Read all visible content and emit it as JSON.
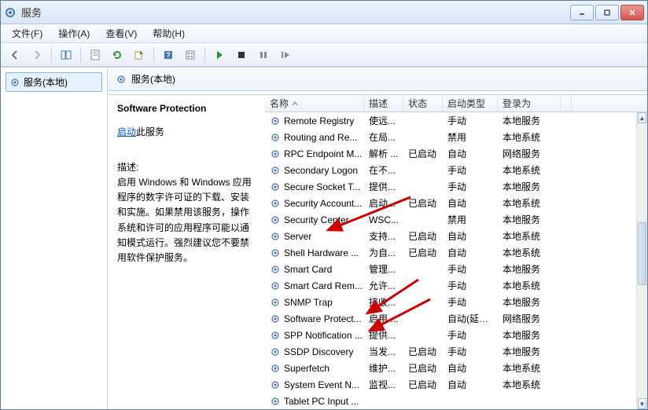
{
  "window": {
    "title": "服务"
  },
  "menu": {
    "file": "文件(F)",
    "action": "操作(A)",
    "view": "查看(V)",
    "help": "帮助(H)"
  },
  "tree": {
    "root": "服务(本地)"
  },
  "panel": {
    "heading": "服务(本地)"
  },
  "details": {
    "title": "Software Protection",
    "start_label": "启动",
    "start_suffix": "此服务",
    "desc_label": "描述:",
    "desc_text": "启用 Windows 和 Windows 应用程序的数字许可证的下载、安装和实施。如果禁用该服务，操作系统和许可的应用程序可能以通知模式运行。强烈建议您不要禁用软件保护服务。"
  },
  "columns": {
    "name": "名称",
    "desc": "描述",
    "status": "状态",
    "startup": "启动类型",
    "logon": "登录为"
  },
  "rows": [
    {
      "name": "Remote Registry",
      "desc": "使远...",
      "status": "",
      "startup": "手动",
      "logon": "本地服务"
    },
    {
      "name": "Routing and Re...",
      "desc": "在局...",
      "status": "",
      "startup": "禁用",
      "logon": "本地系统"
    },
    {
      "name": "RPC Endpoint M...",
      "desc": "解析 ...",
      "status": "已启动",
      "startup": "自动",
      "logon": "网络服务"
    },
    {
      "name": "Secondary Logon",
      "desc": "在不...",
      "status": "",
      "startup": "手动",
      "logon": "本地系统"
    },
    {
      "name": "Secure Socket T...",
      "desc": "提供...",
      "status": "",
      "startup": "手动",
      "logon": "本地服务"
    },
    {
      "name": "Security Account...",
      "desc": "启动...",
      "status": "已启动",
      "startup": "自动",
      "logon": "本地系统"
    },
    {
      "name": "Security Center",
      "desc": "WSC...",
      "status": "",
      "startup": "禁用",
      "logon": "本地服务"
    },
    {
      "name": "Server",
      "desc": "支持...",
      "status": "已启动",
      "startup": "自动",
      "logon": "本地系统"
    },
    {
      "name": "Shell Hardware ...",
      "desc": "为自...",
      "status": "已启动",
      "startup": "自动",
      "logon": "本地系统"
    },
    {
      "name": "Smart Card",
      "desc": "管理...",
      "status": "",
      "startup": "手动",
      "logon": "本地服务"
    },
    {
      "name": "Smart Card Rem...",
      "desc": "允许...",
      "status": "",
      "startup": "手动",
      "logon": "本地系统"
    },
    {
      "name": "SNMP Trap",
      "desc": "接收...",
      "status": "",
      "startup": "手动",
      "logon": "本地服务"
    },
    {
      "name": "Software Protect...",
      "desc": "启用 ...",
      "status": "",
      "startup": "自动(延迟...",
      "logon": "网络服务"
    },
    {
      "name": "SPP Notification ...",
      "desc": "提供...",
      "status": "",
      "startup": "手动",
      "logon": "本地服务"
    },
    {
      "name": "SSDP Discovery",
      "desc": "当发...",
      "status": "已启动",
      "startup": "手动",
      "logon": "本地服务"
    },
    {
      "name": "Superfetch",
      "desc": "维护...",
      "status": "已启动",
      "startup": "自动",
      "logon": "本地系统"
    },
    {
      "name": "System Event N...",
      "desc": "监视...",
      "status": "已启动",
      "startup": "自动",
      "logon": "本地系统"
    },
    {
      "name": "Tablet PC Input ...",
      "desc": "",
      "status": "",
      "startup": "",
      "logon": ""
    }
  ]
}
